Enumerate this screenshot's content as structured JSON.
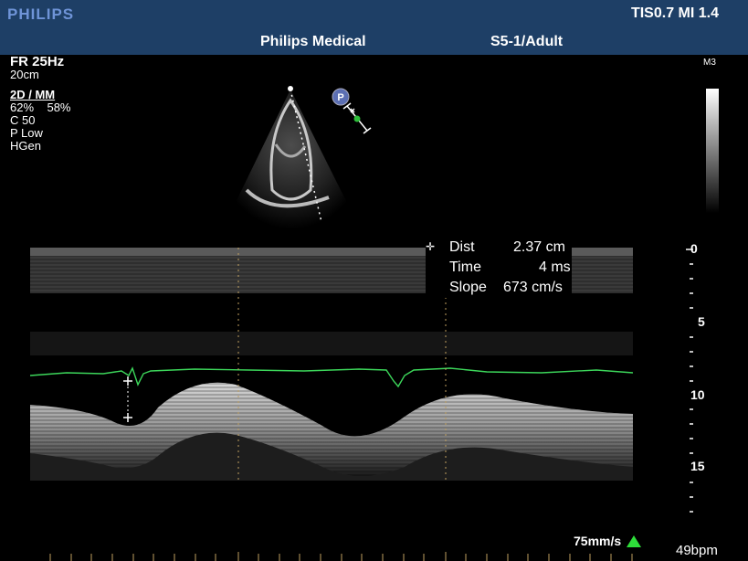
{
  "header": {
    "brand": "PHILIPS",
    "tis_mi": "TIS0.7   MI 1.4",
    "center_title": "Philips Medical",
    "probe_preset": "S5-1/Adult"
  },
  "params": {
    "frame_rate": "FR 25Hz",
    "depth": "20cm",
    "mode": "2D / MM",
    "gain": "62%    58%",
    "compression": "C 50",
    "power": "P Low",
    "frequency": "HGen"
  },
  "gray_map": "M3",
  "icons": {
    "probe_marker": "P"
  },
  "measurement": {
    "dist_label": "Dist",
    "dist_value": "2.37 cm",
    "time_label": "Time",
    "time_value": "4 ms",
    "slope_label": "Slope",
    "slope_value": "673 cm/s"
  },
  "depth_scale": [
    "0",
    "5",
    "10",
    "15"
  ],
  "sweep_speed": "75mm/s",
  "heart_rate": "49bpm",
  "colors": {
    "header_bg": "#1e3f66",
    "brand": "#6f94d8",
    "ecg": "#3cd65a",
    "caliper": "#c0a060",
    "speed_icon": "#2ede3a"
  }
}
